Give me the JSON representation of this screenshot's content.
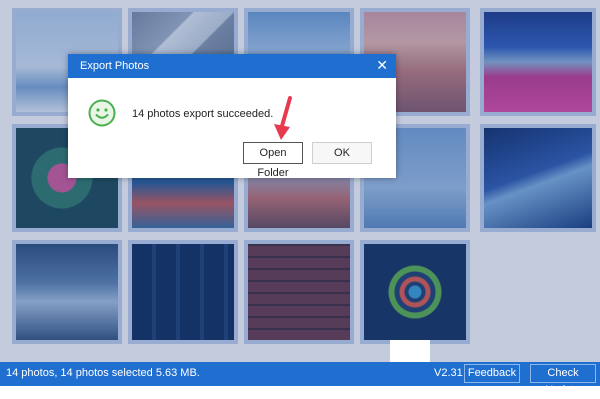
{
  "dialog": {
    "title": "Export Photos",
    "close_glyph": "✕",
    "message": "14 photos export succeeded.",
    "open_folder_label": "Open Folder",
    "ok_label": "OK",
    "success_icon": "smiley-face-icon"
  },
  "statusbar": {
    "status_text": "14 photos, 14 photos selected 5.63 MB.",
    "version": "V2.31",
    "feedback_label": "Feedback",
    "check_update_label": "Check Update"
  },
  "colors": {
    "accent": "#1f6fd0",
    "thumb_border": "#c3d5ef",
    "pointer_arrow": "#e83a4f",
    "success_green": "#4caf50"
  },
  "photos_total": 14,
  "photos_selected": 14
}
